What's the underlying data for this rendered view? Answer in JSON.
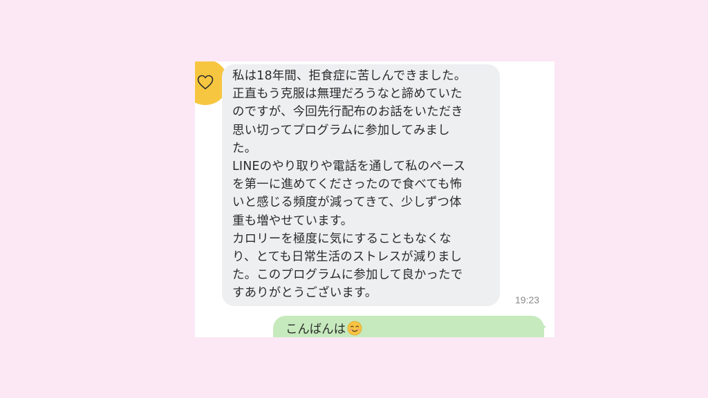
{
  "colors": {
    "page_background": "#fbe8f4",
    "panel_background": "#ffffff",
    "avatar_background": "#f7c640",
    "incoming_bubble": "#eeeff1",
    "outgoing_bubble": "#c6eabd",
    "timestamp": "#8a8a8a"
  },
  "avatar": {
    "icon": "heart-icon"
  },
  "incoming_message": {
    "lines": [
      "私は18年間、拒食症に苦しんできました。",
      "正直もう克服は無理だろうなと諦めていた",
      "のですが、今回先行配布のお話をいただき",
      "思い切ってプログラムに参加してみまし",
      "た。",
      "LINEのやり取りや電話を通して私のペース",
      "を第一に進めてくださったので食べても怖",
      "いと感じる頻度が減ってきて、少しずつ体",
      "重も増やせています。",
      "カロリーを極度に気にすることもなくな",
      "り、とても日常生活のストレスが減りまし",
      "た。このプログラムに参加して良かったで",
      "すありがとうございます。"
    ],
    "time": "19:23"
  },
  "outgoing_message": {
    "text": "こんばんは",
    "emoji": "smiling-face-emoji"
  }
}
